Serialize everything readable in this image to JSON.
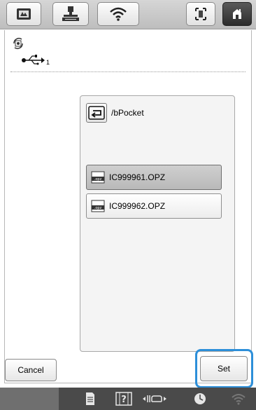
{
  "toolbar": {
    "buttons": [
      {
        "icon": "embroidery-card-icon"
      },
      {
        "icon": "embroidery-unit-icon"
      },
      {
        "icon": "wifi-icon"
      },
      {
        "icon": "frame-icon"
      },
      {
        "icon": "home-icon"
      }
    ]
  },
  "location": {
    "icon": "save-location-icon",
    "usb_icon": "usb-icon",
    "usb_port": "1"
  },
  "browser": {
    "path": "/bPocket",
    "files": [
      {
        "name": "IC999961.OPZ",
        "selected": true
      },
      {
        "name": "IC999962.OPZ",
        "selected": false
      }
    ]
  },
  "footer": {
    "cancel_label": "Cancel",
    "set_label": "Set"
  },
  "statusbar": {
    "icons": [
      "document-icon",
      "help-icon",
      "needle-position-icon",
      "clock-icon",
      "wifi-status-icon"
    ]
  },
  "colors": {
    "highlight": "#2d8fd9",
    "toolbar": "#c9c9c9",
    "statusbar": "#4a4a4a"
  }
}
